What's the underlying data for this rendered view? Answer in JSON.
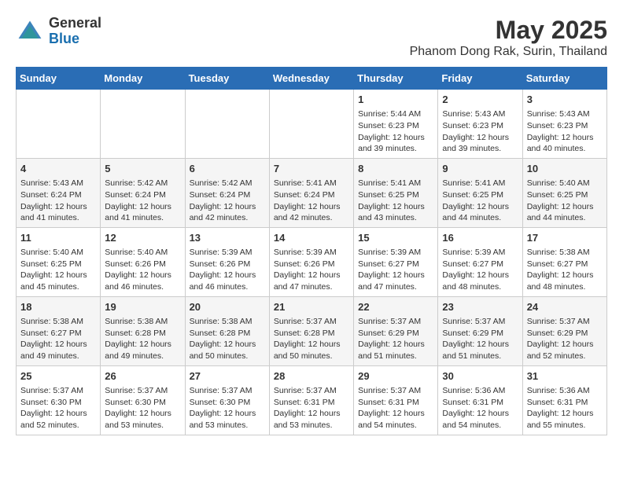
{
  "logo": {
    "general": "General",
    "blue": "Blue"
  },
  "title": "May 2025",
  "subtitle": "Phanom Dong Rak, Surin, Thailand",
  "days_of_week": [
    "Sunday",
    "Monday",
    "Tuesday",
    "Wednesday",
    "Thursday",
    "Friday",
    "Saturday"
  ],
  "weeks": [
    [
      {
        "day": "",
        "content": ""
      },
      {
        "day": "",
        "content": ""
      },
      {
        "day": "",
        "content": ""
      },
      {
        "day": "",
        "content": ""
      },
      {
        "day": "1",
        "content": "Sunrise: 5:44 AM\nSunset: 6:23 PM\nDaylight: 12 hours\nand 39 minutes."
      },
      {
        "day": "2",
        "content": "Sunrise: 5:43 AM\nSunset: 6:23 PM\nDaylight: 12 hours\nand 39 minutes."
      },
      {
        "day": "3",
        "content": "Sunrise: 5:43 AM\nSunset: 6:23 PM\nDaylight: 12 hours\nand 40 minutes."
      }
    ],
    [
      {
        "day": "4",
        "content": "Sunrise: 5:43 AM\nSunset: 6:24 PM\nDaylight: 12 hours\nand 41 minutes."
      },
      {
        "day": "5",
        "content": "Sunrise: 5:42 AM\nSunset: 6:24 PM\nDaylight: 12 hours\nand 41 minutes."
      },
      {
        "day": "6",
        "content": "Sunrise: 5:42 AM\nSunset: 6:24 PM\nDaylight: 12 hours\nand 42 minutes."
      },
      {
        "day": "7",
        "content": "Sunrise: 5:41 AM\nSunset: 6:24 PM\nDaylight: 12 hours\nand 42 minutes."
      },
      {
        "day": "8",
        "content": "Sunrise: 5:41 AM\nSunset: 6:25 PM\nDaylight: 12 hours\nand 43 minutes."
      },
      {
        "day": "9",
        "content": "Sunrise: 5:41 AM\nSunset: 6:25 PM\nDaylight: 12 hours\nand 44 minutes."
      },
      {
        "day": "10",
        "content": "Sunrise: 5:40 AM\nSunset: 6:25 PM\nDaylight: 12 hours\nand 44 minutes."
      }
    ],
    [
      {
        "day": "11",
        "content": "Sunrise: 5:40 AM\nSunset: 6:25 PM\nDaylight: 12 hours\nand 45 minutes."
      },
      {
        "day": "12",
        "content": "Sunrise: 5:40 AM\nSunset: 6:26 PM\nDaylight: 12 hours\nand 46 minutes."
      },
      {
        "day": "13",
        "content": "Sunrise: 5:39 AM\nSunset: 6:26 PM\nDaylight: 12 hours\nand 46 minutes."
      },
      {
        "day": "14",
        "content": "Sunrise: 5:39 AM\nSunset: 6:26 PM\nDaylight: 12 hours\nand 47 minutes."
      },
      {
        "day": "15",
        "content": "Sunrise: 5:39 AM\nSunset: 6:27 PM\nDaylight: 12 hours\nand 47 minutes."
      },
      {
        "day": "16",
        "content": "Sunrise: 5:39 AM\nSunset: 6:27 PM\nDaylight: 12 hours\nand 48 minutes."
      },
      {
        "day": "17",
        "content": "Sunrise: 5:38 AM\nSunset: 6:27 PM\nDaylight: 12 hours\nand 48 minutes."
      }
    ],
    [
      {
        "day": "18",
        "content": "Sunrise: 5:38 AM\nSunset: 6:27 PM\nDaylight: 12 hours\nand 49 minutes."
      },
      {
        "day": "19",
        "content": "Sunrise: 5:38 AM\nSunset: 6:28 PM\nDaylight: 12 hours\nand 49 minutes."
      },
      {
        "day": "20",
        "content": "Sunrise: 5:38 AM\nSunset: 6:28 PM\nDaylight: 12 hours\nand 50 minutes."
      },
      {
        "day": "21",
        "content": "Sunrise: 5:37 AM\nSunset: 6:28 PM\nDaylight: 12 hours\nand 50 minutes."
      },
      {
        "day": "22",
        "content": "Sunrise: 5:37 AM\nSunset: 6:29 PM\nDaylight: 12 hours\nand 51 minutes."
      },
      {
        "day": "23",
        "content": "Sunrise: 5:37 AM\nSunset: 6:29 PM\nDaylight: 12 hours\nand 51 minutes."
      },
      {
        "day": "24",
        "content": "Sunrise: 5:37 AM\nSunset: 6:29 PM\nDaylight: 12 hours\nand 52 minutes."
      }
    ],
    [
      {
        "day": "25",
        "content": "Sunrise: 5:37 AM\nSunset: 6:30 PM\nDaylight: 12 hours\nand 52 minutes."
      },
      {
        "day": "26",
        "content": "Sunrise: 5:37 AM\nSunset: 6:30 PM\nDaylight: 12 hours\nand 53 minutes."
      },
      {
        "day": "27",
        "content": "Sunrise: 5:37 AM\nSunset: 6:30 PM\nDaylight: 12 hours\nand 53 minutes."
      },
      {
        "day": "28",
        "content": "Sunrise: 5:37 AM\nSunset: 6:31 PM\nDaylight: 12 hours\nand 53 minutes."
      },
      {
        "day": "29",
        "content": "Sunrise: 5:37 AM\nSunset: 6:31 PM\nDaylight: 12 hours\nand 54 minutes."
      },
      {
        "day": "30",
        "content": "Sunrise: 5:36 AM\nSunset: 6:31 PM\nDaylight: 12 hours\nand 54 minutes."
      },
      {
        "day": "31",
        "content": "Sunrise: 5:36 AM\nSunset: 6:31 PM\nDaylight: 12 hours\nand 55 minutes."
      }
    ]
  ]
}
